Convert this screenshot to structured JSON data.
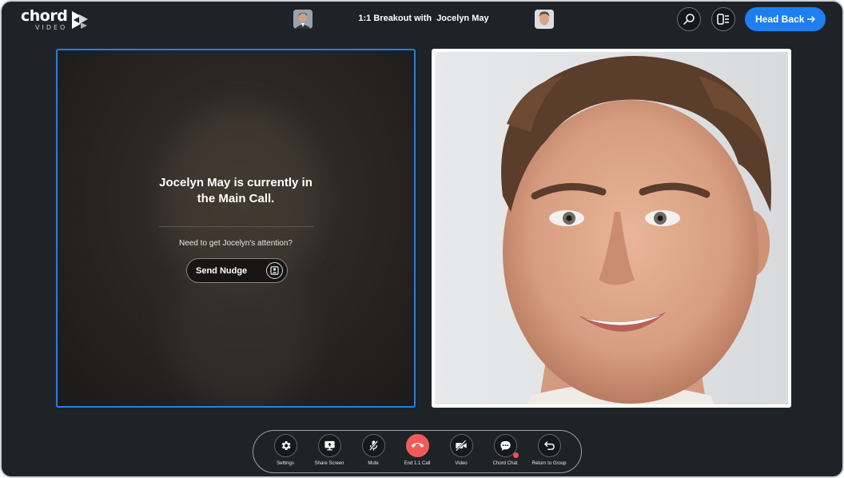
{
  "app": {
    "logo_word": "chord",
    "logo_sub": "VIDEO"
  },
  "header": {
    "title": "1:1 Breakout with  Jocelyn May",
    "head_back_label": "Head Back"
  },
  "left_panel": {
    "status_line1": "Jocelyn May is currently in",
    "status_line2": "the Main Call.",
    "prompt": "Need to get Jocelyn's attention?",
    "nudge_label": "Send Nudge"
  },
  "toolbar": {
    "items": [
      {
        "label": "Settings",
        "icon": "gear-icon"
      },
      {
        "label": "Share Screen",
        "icon": "share-screen-icon"
      },
      {
        "label": "Mute",
        "icon": "mic-off-icon"
      },
      {
        "label": "End 1:1 Call",
        "icon": "end-call-icon"
      },
      {
        "label": "Video",
        "icon": "video-off-icon"
      },
      {
        "label": "Chord Chat",
        "icon": "chat-icon"
      },
      {
        "label": "Return to Group",
        "icon": "return-icon"
      }
    ]
  },
  "colors": {
    "accent": "#1e7ff0",
    "background": "#1f2328",
    "end_call": "#f25a5a"
  }
}
